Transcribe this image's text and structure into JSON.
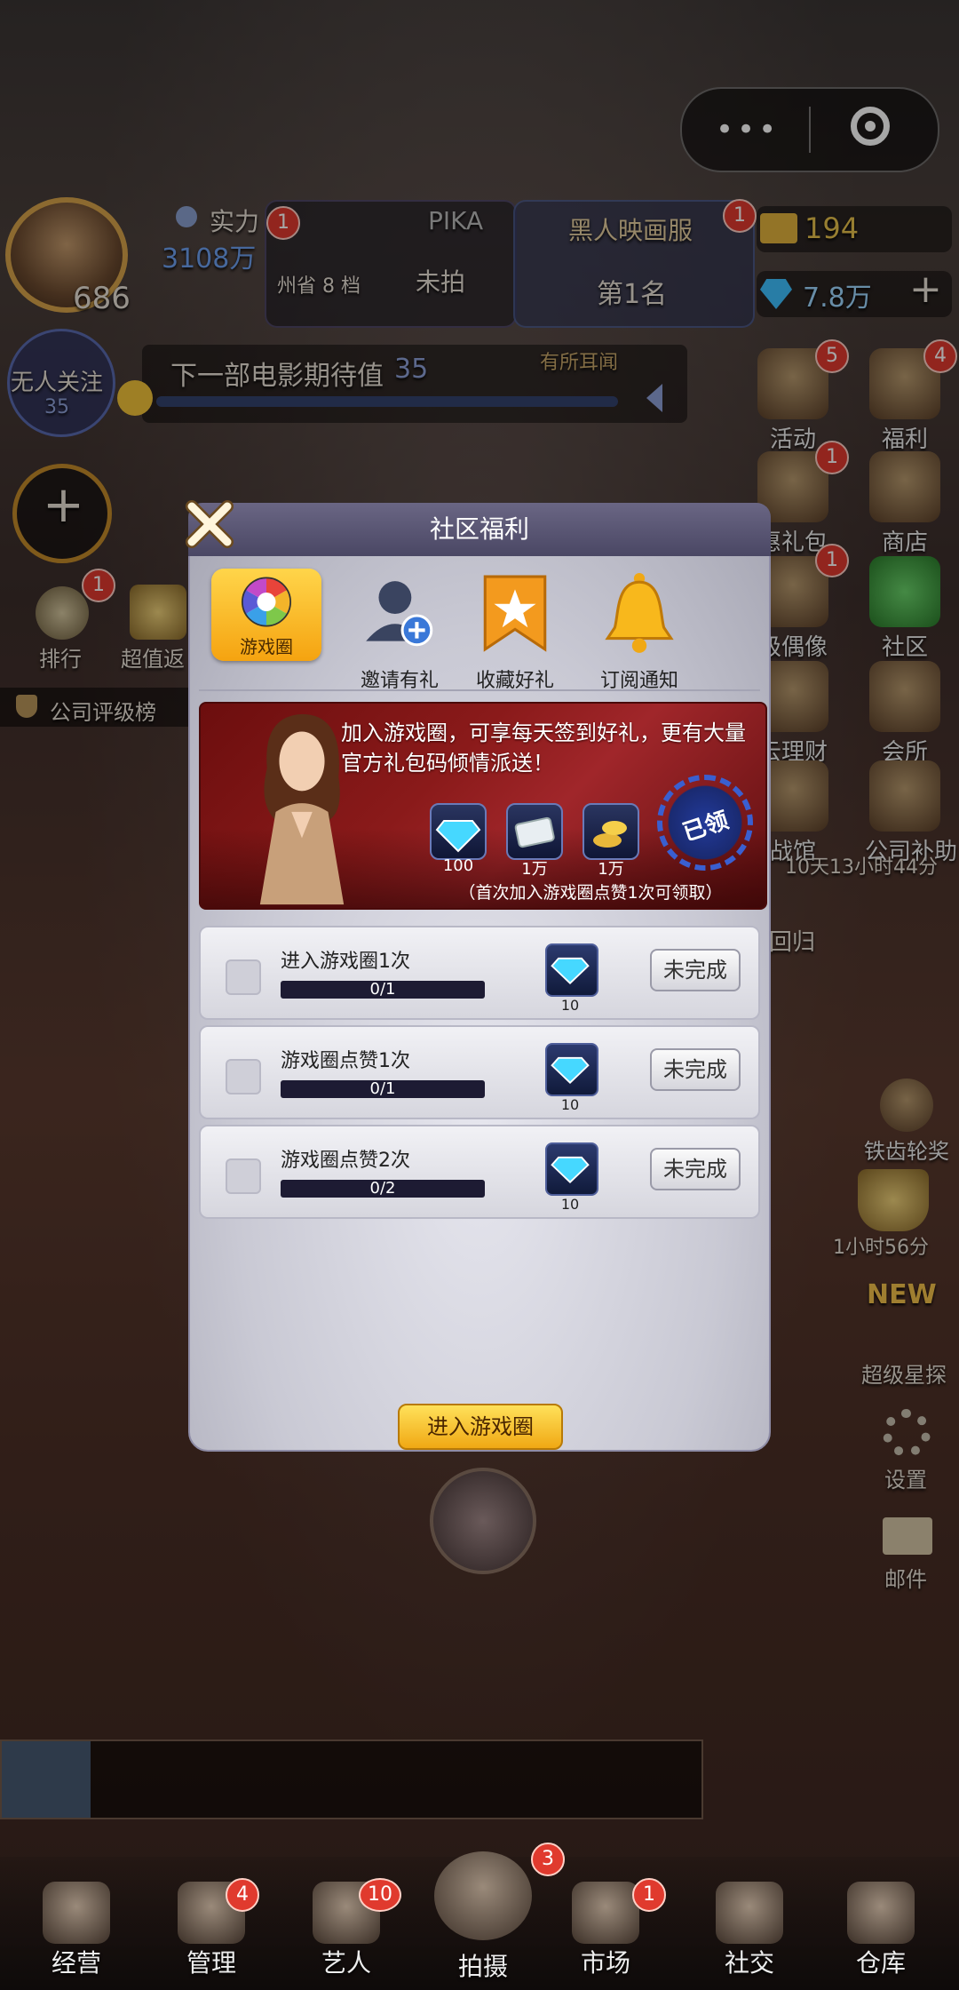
{
  "hud": {
    "player_level": "686",
    "power_label": "实力",
    "power_value": "3108万",
    "follow_text": "无人关注",
    "follow_count": "35",
    "pika_title": "PIKA",
    "pika_sub": "州省 8 档",
    "pika_status": "未拍",
    "pika_badge": "1",
    "rank_title": "黑人映画服",
    "rank_value": "第1名",
    "rank_badge": "1",
    "gold": "194",
    "gems": "7.8万",
    "add_symbol": "+",
    "movie_expect": "下一部电影期待值",
    "movie_expect_value": "35",
    "news_label": "有所耳闻"
  },
  "left_buttons": {
    "add": "+",
    "rank": "排行",
    "rank_badge": "1",
    "value": "超值返",
    "company_rank": "公司评级榜"
  },
  "right_buttons": [
    {
      "label": "活动",
      "badge": "5"
    },
    {
      "label": "福利",
      "badge": "4"
    },
    {
      "label": "惠礼包",
      "badge": "1"
    },
    {
      "label": "商店",
      "badge": ""
    },
    {
      "label": "级偶像",
      "badge": "1"
    },
    {
      "label": "社区",
      "badge": ""
    },
    {
      "label": "云理财",
      "badge": ""
    },
    {
      "label": "会所",
      "badge": ""
    },
    {
      "label": "战馆",
      "badge": ""
    },
    {
      "label": "公司补助",
      "badge": ""
    }
  ],
  "side_timer": "10天13小时44分",
  "side_return": "回归",
  "right_lower": [
    {
      "label": "铁齿轮奖"
    },
    {
      "label": "1小时56分"
    },
    {
      "label": "NEW"
    },
    {
      "label": "超级星探"
    },
    {
      "label": "设置"
    },
    {
      "label": "邮件"
    }
  ],
  "dialog": {
    "title": "社区福利",
    "tabs": [
      {
        "label": "游戏圈",
        "active": true
      },
      {
        "label": "邀请有礼",
        "active": false
      },
      {
        "label": "收藏好礼",
        "active": false
      },
      {
        "label": "订阅通知",
        "active": false
      }
    ],
    "banner_text": "加入游戏圈，可享每天签到好礼，更有大量官方礼包码倾情派送！",
    "banner_note": "（首次加入游戏圈点赞1次可领取）",
    "rewards": [
      {
        "icon": "diamond-icon",
        "label": "100"
      },
      {
        "icon": "cash-icon",
        "label": "1万"
      },
      {
        "icon": "gold-icon",
        "label": "1万"
      }
    ],
    "claimed_stamp": "已领",
    "tasks": [
      {
        "name": "进入游戏圈1次",
        "progress_text": "0/1",
        "progress": 0,
        "reward": "10",
        "button": "未完成"
      },
      {
        "name": "游戏圈点赞1次",
        "progress_text": "0/1",
        "progress": 0,
        "reward": "10",
        "button": "未完成"
      },
      {
        "name": "游戏圈点赞2次",
        "progress_text": "0/2",
        "progress": 0,
        "reward": "10",
        "button": "未完成"
      }
    ],
    "enter_button": "进入游戏圈"
  },
  "nav": [
    {
      "label": "经营",
      "badge": ""
    },
    {
      "label": "管理",
      "badge": "4"
    },
    {
      "label": "艺人",
      "badge": "10"
    },
    {
      "label": "拍摄",
      "badge": "3"
    },
    {
      "label": "市场",
      "badge": "1"
    },
    {
      "label": "社交",
      "badge": ""
    },
    {
      "label": "仓库",
      "badge": ""
    }
  ],
  "colors": {
    "accent_yellow": "#f5a310",
    "badge_red": "#e03a2e",
    "dialog_header": "#5a5776"
  }
}
